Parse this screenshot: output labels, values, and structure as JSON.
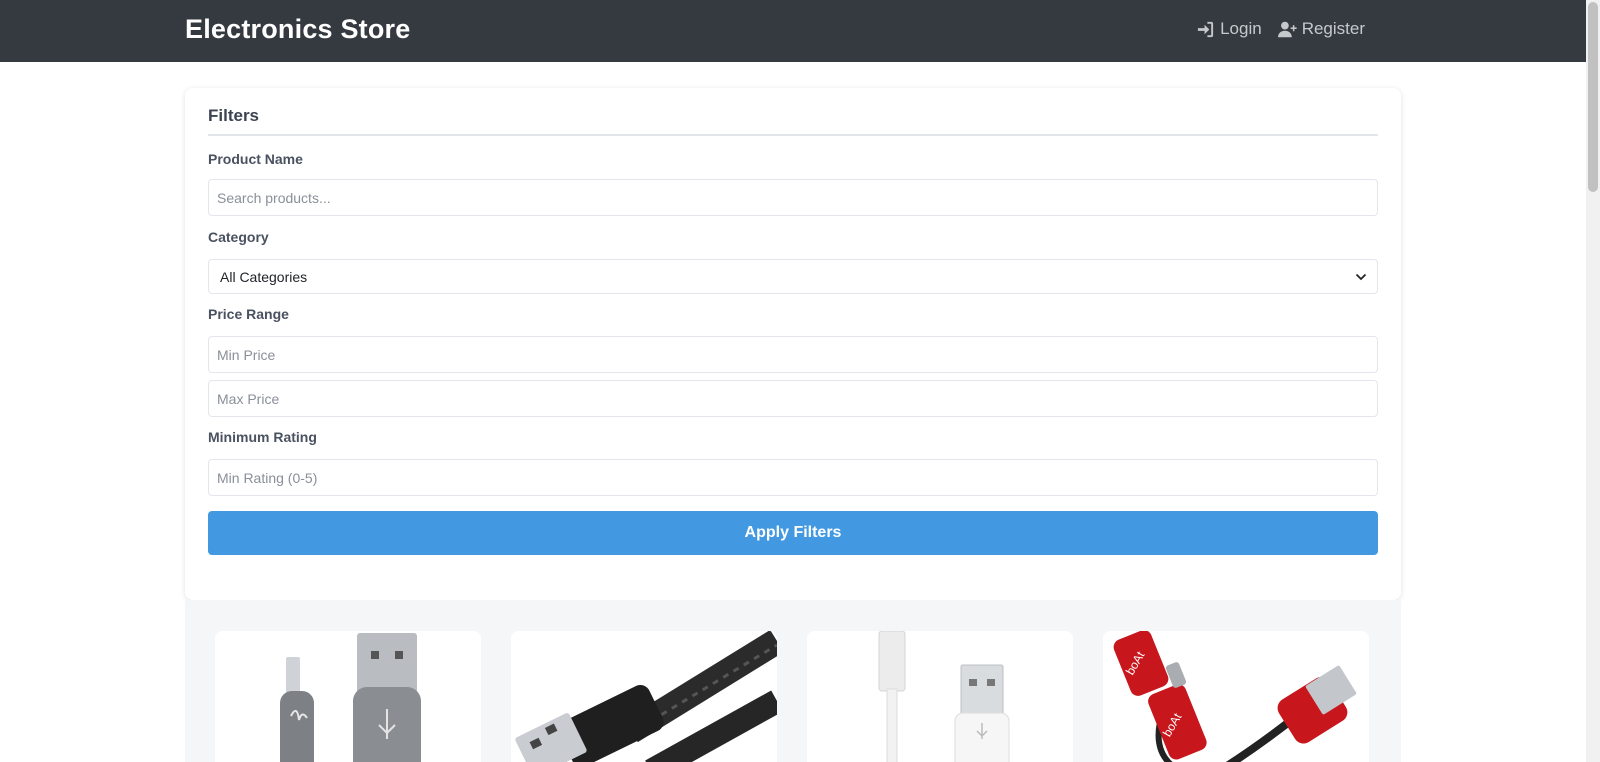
{
  "header": {
    "brand": "Electronics Store",
    "login_label": "Login",
    "register_label": "Register"
  },
  "filters": {
    "title": "Filters",
    "product_name_label": "Product Name",
    "product_name_placeholder": "Search products...",
    "category_label": "Category",
    "category_selected": "All Categories",
    "price_range_label": "Price Range",
    "min_price_placeholder": "Min Price",
    "max_price_placeholder": "Max Price",
    "rating_label": "Minimum Rating",
    "rating_placeholder": "Min Rating (0-5)",
    "apply_label": "Apply Filters"
  },
  "products": [
    {
      "image": "grey-lightning-usb-cable"
    },
    {
      "image": "black-braided-usb-cable"
    },
    {
      "image": "white-usb-cable"
    },
    {
      "image": "red-boat-dual-usb-cable"
    }
  ],
  "colors": {
    "header_bg": "#343a40",
    "accent": "#4299e1",
    "grid_bg": "#f5f6f8"
  }
}
